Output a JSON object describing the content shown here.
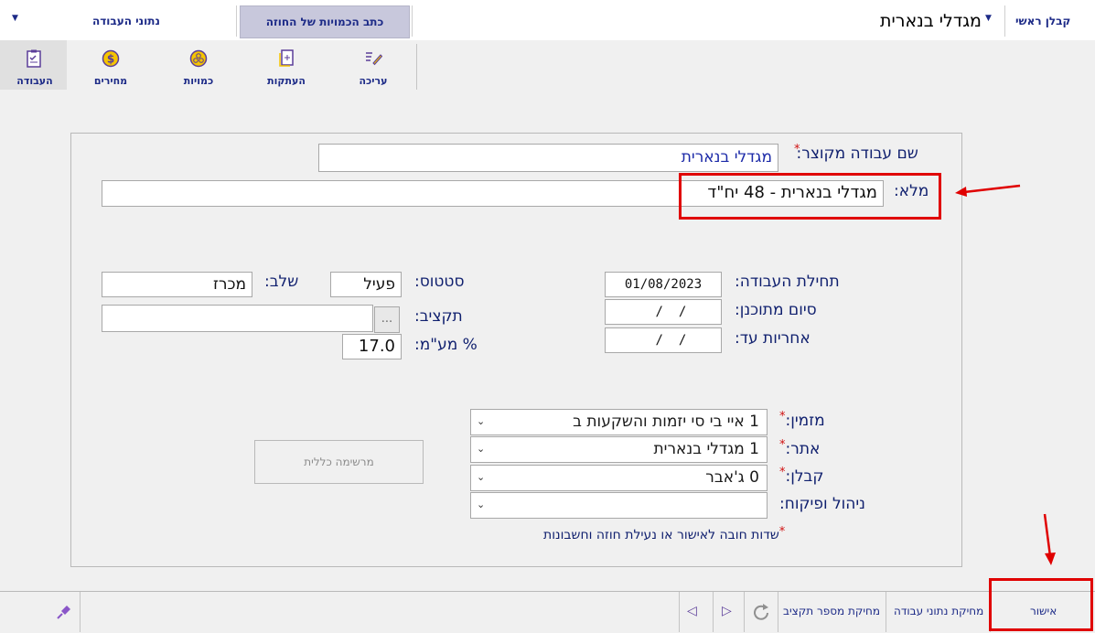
{
  "header": {
    "role_label": "קבלן ראשי",
    "project_title": "מגדלי בנארית",
    "tab_quantities": "כתב הכמויות של החוזה",
    "tab_work_details": "נתוני העבודה"
  },
  "toolbar": {
    "items": [
      {
        "label": "העבודה",
        "icon": "clipboard-checklist-icon"
      },
      {
        "label": "מחירים",
        "icon": "dollar-coin-icon"
      },
      {
        "label": "כמויות",
        "icon": "stacked-coins-icon"
      },
      {
        "label": "העתקות",
        "icon": "copy-document-icon"
      },
      {
        "label": "עריכה",
        "icon": "edit-pencil-icon"
      }
    ]
  },
  "form": {
    "short_name_label": "שם עבודה מקוצר:",
    "short_name_value": "מגדלי בנארית",
    "full_name_label": "מלא:",
    "full_name_value": "מגדלי בנארית - 48 יח\"ד",
    "start_label": "תחילת העבודה:",
    "start_value": "01/08/2023",
    "planned_end_label": "סיום מתוכנן:",
    "planned_end_value": "  /  /",
    "warranty_label": "אחריות עד:",
    "warranty_value": "  /  /",
    "status_label": "סטטוס:",
    "status_value": "פעיל",
    "stage_label": "שלב:",
    "stage_value": "מכרז",
    "budget_label": "תקציב:",
    "budget_value": "",
    "budget_browse": "...",
    "vat_label": "% מע\"מ:",
    "vat_value": "17.0",
    "orderer_label": "מזמין:",
    "orderer_value": "1  איי בי סי יזמות והשקעות ב",
    "site_label": "אתר:",
    "site_value": "1  מגדלי בנארית",
    "contractor_label": "קבלן:",
    "contractor_value": "0  ג'אבר",
    "management_label": "ניהול ופיקוח:",
    "management_value": "",
    "general_list_button": "מרשימה כללית",
    "required_note": "שדות חובה לאישור או נעילת חוזה וחשבונות"
  },
  "bottom": {
    "approve": "אישור",
    "delete_work_data": "מחיקת נתוני עבודה",
    "delete_budget_number": "מחיקת מספר תקציב"
  },
  "colors": {
    "accent": "#1c2a87",
    "highlight": "#e00000",
    "required_star": "#d01010"
  }
}
